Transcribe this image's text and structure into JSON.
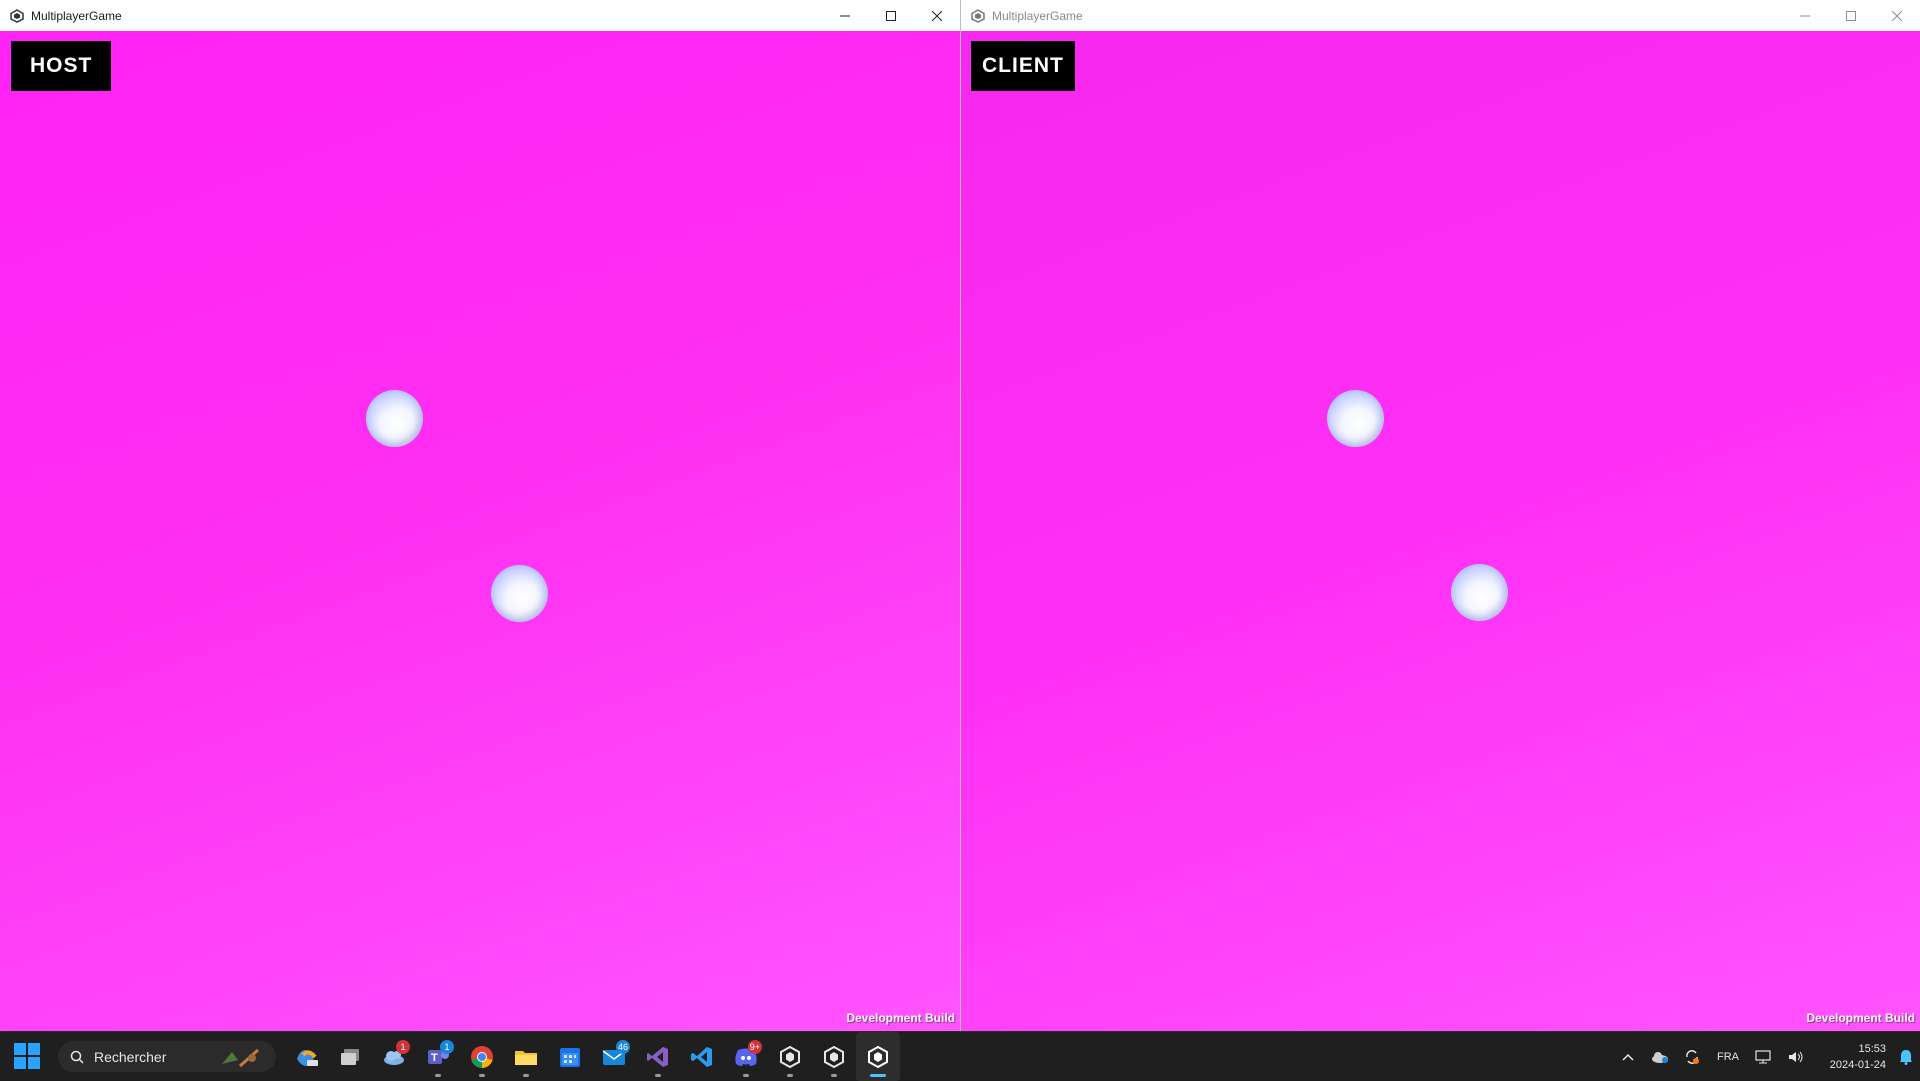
{
  "windows": {
    "host": {
      "title": "MultiplayerGame",
      "role": "HOST",
      "footer": "Development Build",
      "players": [
        {
          "name": "player-ball-1"
        },
        {
          "name": "player-ball-2"
        }
      ]
    },
    "client": {
      "title": "MultiplayerGame",
      "role": "CLIENT",
      "footer": "Development Build",
      "players": [
        {
          "name": "player-ball-1"
        },
        {
          "name": "player-ball-2"
        }
      ]
    }
  },
  "colors": {
    "game_background": "#ff2ef5",
    "badge_background": "#000000",
    "badge_text": "#ffffff"
  },
  "taskbar": {
    "search_placeholder": "Rechercher",
    "apps": [
      {
        "name": "copilot",
        "icon": "copilot-icon"
      },
      {
        "name": "task-view",
        "icon": "task-view-icon"
      },
      {
        "name": "onedrive",
        "icon": "cloud-icon",
        "badge": "1"
      },
      {
        "name": "teams",
        "icon": "teams-icon",
        "badge": "1"
      },
      {
        "name": "chrome",
        "icon": "chrome-icon"
      },
      {
        "name": "file-explorer",
        "icon": "folder-icon"
      },
      {
        "name": "calendar",
        "icon": "calendar-icon"
      },
      {
        "name": "mail",
        "icon": "mail-icon",
        "badge": "46"
      },
      {
        "name": "visual-studio",
        "icon": "visual-studio-icon"
      },
      {
        "name": "vscode",
        "icon": "vscode-icon"
      },
      {
        "name": "discord",
        "icon": "discord-icon",
        "badge": "9+"
      },
      {
        "name": "unity-hub",
        "icon": "unity-icon"
      },
      {
        "name": "unity-editor",
        "icon": "unity-icon"
      },
      {
        "name": "multiplayer-game",
        "icon": "unity-icon",
        "active": true
      }
    ],
    "tray": {
      "language": "FRA",
      "time": "15:53",
      "date": "2024-01-24"
    }
  }
}
